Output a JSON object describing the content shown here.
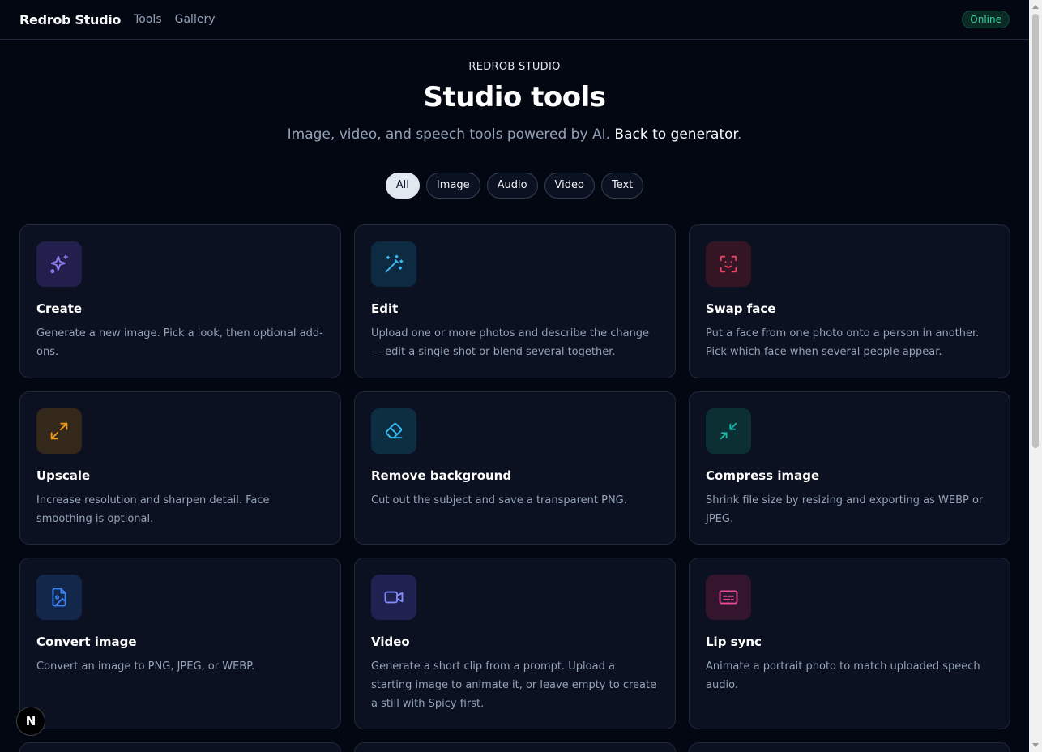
{
  "header": {
    "brand": "Redrob Studio",
    "nav": [
      "Tools",
      "Gallery"
    ],
    "status": "Online"
  },
  "hero": {
    "eyebrow": "REDROB STUDIO",
    "title": "Studio tools",
    "subtitle": "Image, video, and speech tools powered by AI.",
    "back_link": "Back to generator",
    "trailing": "."
  },
  "filters": [
    "All",
    "Image",
    "Audio",
    "Video",
    "Text"
  ],
  "active_filter": "All",
  "tools": [
    {
      "title": "Create",
      "desc": "Generate a new image. Pick a look, then optional add-ons.",
      "icon": "sparkles-icon",
      "color": "#8b7cf6",
      "bg": "#221f4d"
    },
    {
      "title": "Edit",
      "desc": "Upload one or more photos and describe the change — edit a single shot or blend several together.",
      "icon": "magic-wand-icon",
      "color": "#38bdf8",
      "bg": "#0c2a40"
    },
    {
      "title": "Swap face",
      "desc": "Put a face from one photo onto a person in another. Pick which face when several people appear.",
      "icon": "face-scan-icon",
      "color": "#f43f5e",
      "bg": "#331524"
    },
    {
      "title": "Upscale",
      "desc": "Increase resolution and sharpen detail. Face smoothing is optional.",
      "icon": "expand-icon",
      "color": "#f59e0b",
      "bg": "#33281a"
    },
    {
      "title": "Remove background",
      "desc": "Cut out the subject and save a transparent PNG.",
      "icon": "eraser-icon",
      "color": "#38bdf8",
      "bg": "#0c2e40"
    },
    {
      "title": "Compress image",
      "desc": "Shrink file size by resizing and exporting as WEBP or JPEG.",
      "icon": "shrink-icon",
      "color": "#14b8a6",
      "bg": "#0b2f33"
    },
    {
      "title": "Convert image",
      "desc": "Convert an image to PNG, JPEG, or WEBP.",
      "icon": "file-image-icon",
      "color": "#3b82f6",
      "bg": "#13274a"
    },
    {
      "title": "Video",
      "desc": "Generate a short clip from a prompt. Upload a starting image to animate it, or leave empty to create a still with Spicy first.",
      "icon": "video-camera-icon",
      "color": "#818cf8",
      "bg": "#1f2150"
    },
    {
      "title": "Lip sync",
      "desc": "Animate a portrait photo to match uploaded speech audio.",
      "icon": "captions-icon",
      "color": "#ec4899",
      "bg": "#33152e"
    }
  ],
  "dev_badge": "N"
}
